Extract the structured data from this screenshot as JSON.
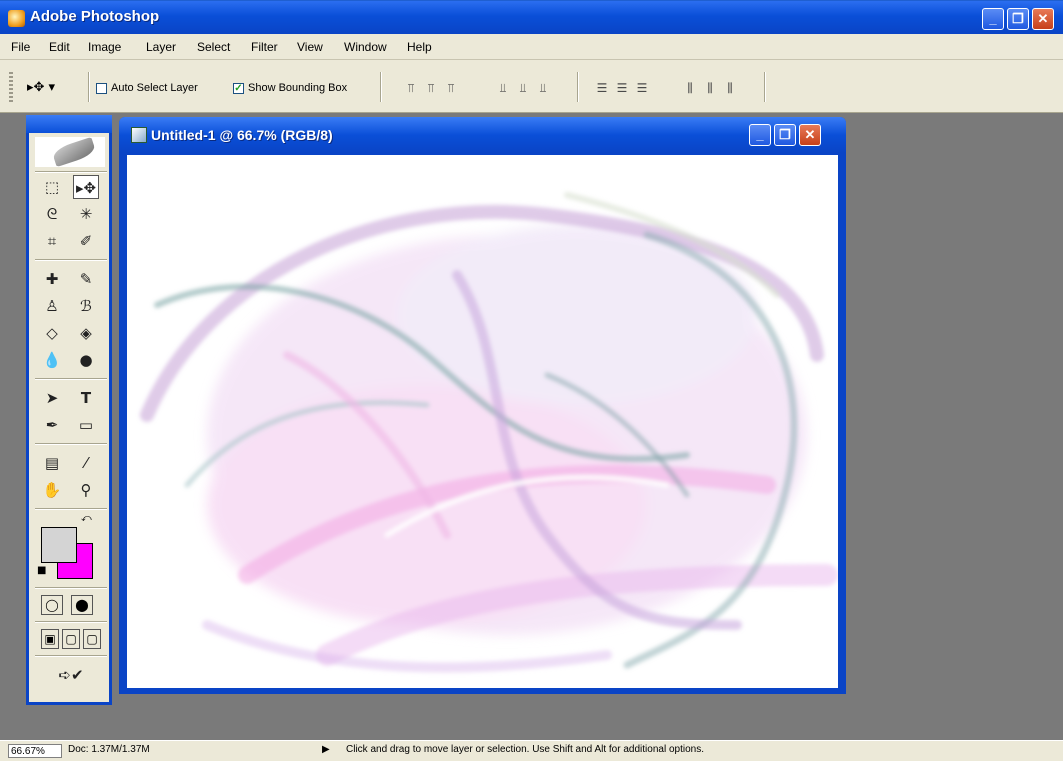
{
  "app": {
    "title": "Adobe Photoshop"
  },
  "menu": [
    "File",
    "Edit",
    "Image",
    "Layer",
    "Select",
    "Filter",
    "View",
    "Window",
    "Help"
  ],
  "options": {
    "auto_select_label": "Auto Select Layer",
    "auto_select_checked": false,
    "show_bbox_label": "Show Bounding Box",
    "show_bbox_checked": true,
    "check_glyph": "✓"
  },
  "document": {
    "title": "Untitled-1 @ 66.7% (RGB/8)"
  },
  "colors": {
    "foreground": "#d4d4d4",
    "background": "#ff00ff",
    "accent": "#0a44c6"
  },
  "status": {
    "zoom": "66.67%",
    "doc": "Doc: 1.37M/1.37M",
    "arrow": "▶",
    "message": "Click and drag to move layer or selection.  Use Shift and Alt for additional options."
  },
  "window_buttons": {
    "minimize": "_",
    "restore": "❐",
    "close": "✕"
  },
  "toolbar_icons": {
    "tool_options": "▸✥ ▾",
    "marquee": "⬚",
    "move": "▸✥",
    "lasso": "ᘓ",
    "magic_wand": "✳",
    "crop": "⌗",
    "slice": "✐",
    "healing": "✚",
    "brush": "✎",
    "clone": "♙",
    "history": "ℬ",
    "eraser": "◇",
    "bucket": "◈",
    "blur": "💧",
    "dodge": "●",
    "path_select": "➤",
    "type": "T",
    "pen": "✒",
    "shape": "▭",
    "notes": "▤",
    "eyedropper": "⁄",
    "hand": "✋",
    "zoom": "⚲",
    "swap": "⤺",
    "default": "■",
    "std_mode": "◯",
    "quickmask_mode": "⬤",
    "screen1": "▣",
    "screen2": "▢",
    "screen3": "▢",
    "jump": "➪✔"
  },
  "align_icons": [
    "⫪",
    "⫪",
    "⫪",
    "⫫",
    "⫫",
    "⫫",
    "☰",
    "☰",
    "☰",
    "⫼",
    "⫼",
    "⫼"
  ]
}
